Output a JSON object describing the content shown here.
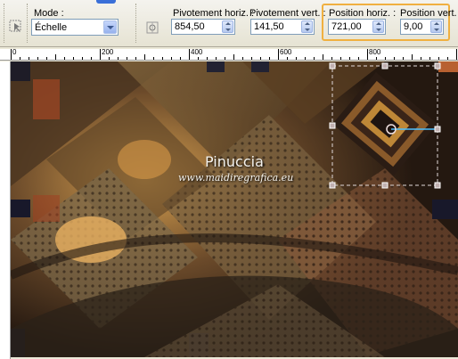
{
  "toolbar": {
    "mode_label": "Mode :",
    "mode_value": "Échelle",
    "pivot_h_label": "Pivotement horiz. :",
    "pivot_h_value": "854,50",
    "pivot_v_label": "Pivotement vert. :",
    "pivot_v_value": "141,50",
    "pos_h_label": "Position horiz. :",
    "pos_h_value": "721,00",
    "pos_v_label": "Position vert. :",
    "pos_v_value": "9,00",
    "highlight_color": "#f0b040"
  },
  "ruler": {
    "labels": [
      "0",
      "200",
      "400",
      "600",
      "800"
    ]
  },
  "canvas": {
    "watermark_title": "Pinuccia",
    "watermark_url": "www.maidiregrafica.eu",
    "icons": [
      "pick-tool-icon",
      "pivot-icon"
    ]
  }
}
